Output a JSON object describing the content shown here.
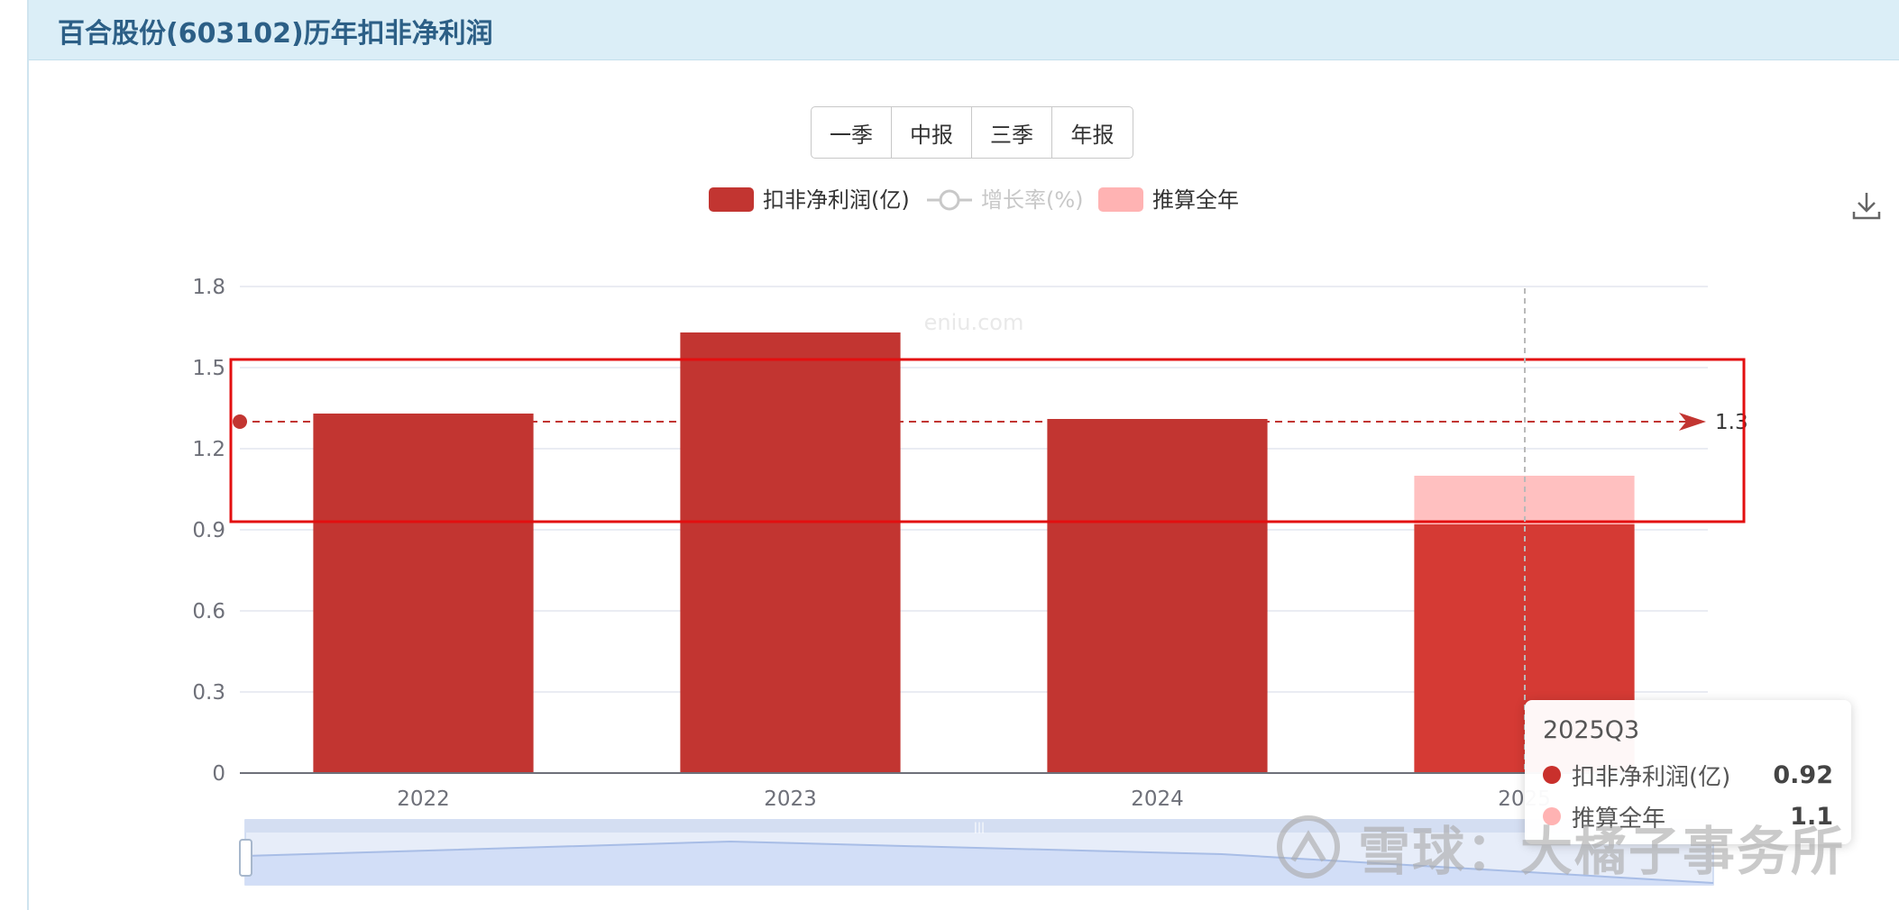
{
  "header": {
    "title": "百合股份(603102)历年扣非净利润"
  },
  "period_tabs": [
    "一季",
    "中报",
    "三季",
    "年报"
  ],
  "watermark_site": "eniu.com",
  "tooltip": {
    "title": "2025Q3",
    "rows": [
      {
        "name": "扣非净利润(亿)",
        "value": "0.92",
        "color": "#c9302c"
      },
      {
        "name": "推算全年",
        "value": "1.1",
        "color": "#ffb3b3"
      }
    ]
  },
  "watermark": {
    "text": "雪球：大橘子事务所"
  },
  "colors": {
    "bar": "#c23531",
    "bar_current": "#d53a34",
    "projection": "#ffc0c0",
    "projection_legend": "#ffb3b3",
    "annotation": "#e30f10",
    "line_disabled": "#c8c8c8"
  },
  "chart_data": {
    "type": "bar",
    "categories": [
      "2022",
      "2023",
      "2024",
      "2025"
    ],
    "series": [
      {
        "name": "扣非净利润(亿)",
        "values": [
          1.33,
          1.63,
          1.31,
          0.92
        ]
      },
      {
        "name": "增长率(%)",
        "values": [],
        "disabled": true
      },
      {
        "name": "推算全年",
        "values": [
          null,
          null,
          null,
          1.1
        ]
      }
    ],
    "y_ticks": [
      "0",
      "0.3",
      "0.6",
      "0.9",
      "1.2",
      "1.5",
      "1.8"
    ],
    "ylim": [
      0,
      1.8
    ],
    "grid": true,
    "legend_position": "top-center",
    "reference_line": {
      "value": 1.3,
      "label": "1.3"
    },
    "highlight_box": {
      "y_range": [
        0.93,
        1.53
      ]
    },
    "data_zoom": true
  }
}
